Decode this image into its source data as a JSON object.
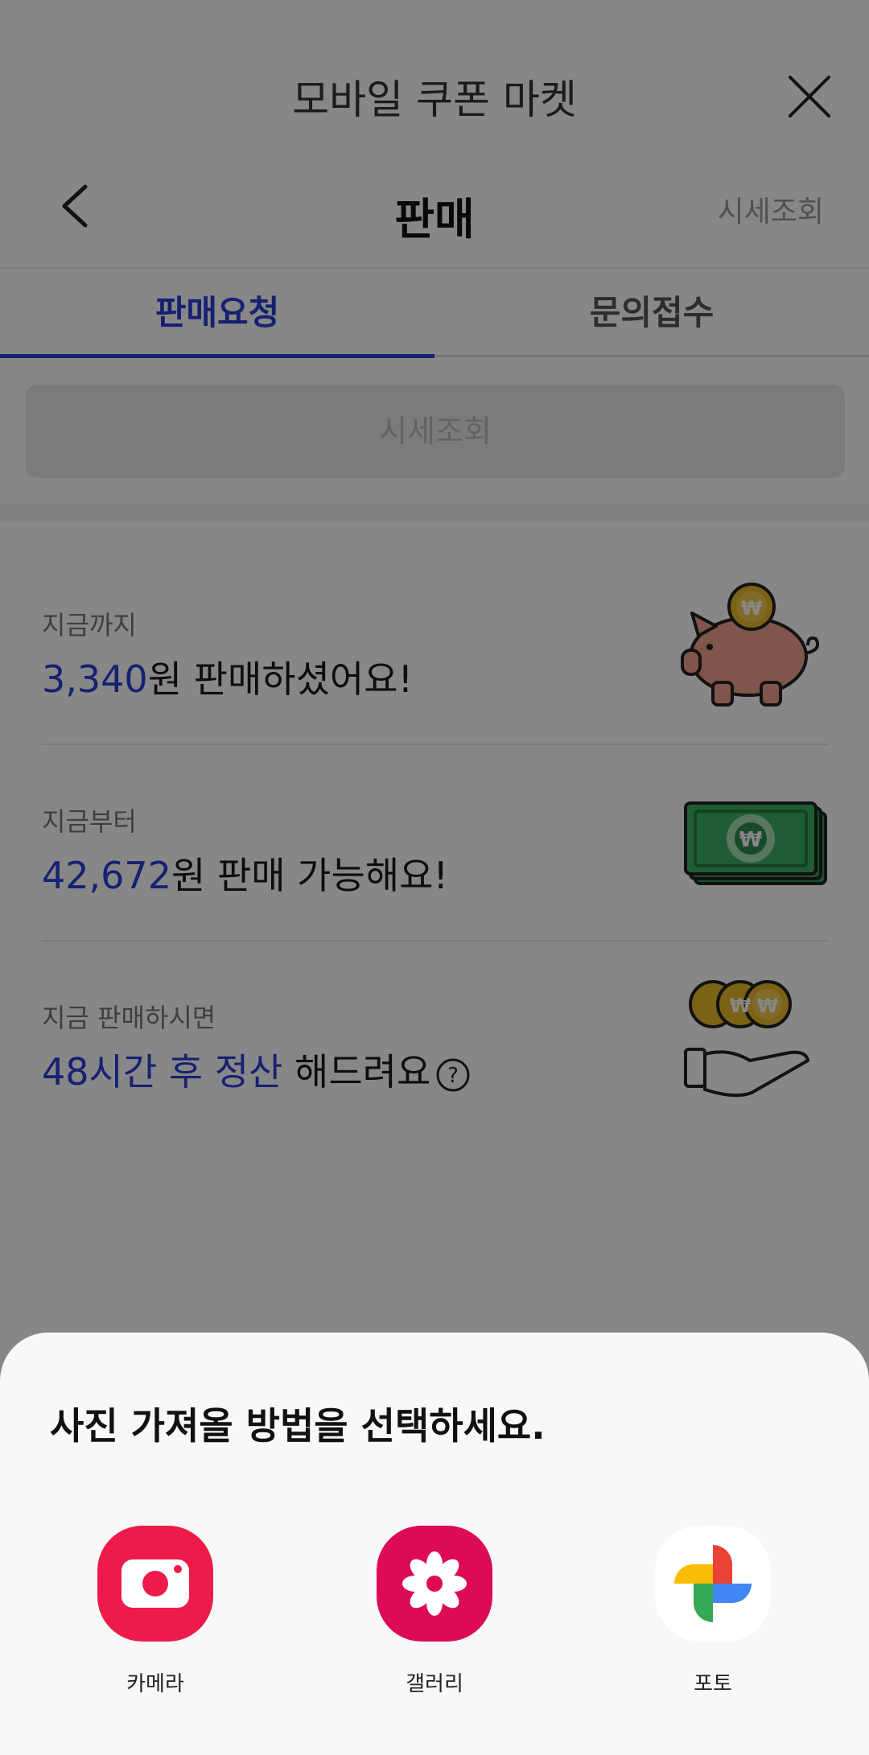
{
  "header": {
    "app_title": "모바일 쿠폰 마켓",
    "page_title": "판매",
    "price_link": "시세조회"
  },
  "tabs": [
    {
      "label": "판매요청",
      "active": true
    },
    {
      "label": "문의접수",
      "active": false
    }
  ],
  "lookup_button": "시세조회",
  "info_rows": [
    {
      "label": "지금까지",
      "highlight": "3,340",
      "text": "원 판매하셨어요!",
      "icon": "piggy-bank-icon"
    },
    {
      "label": "지금부터",
      "highlight": "42,672",
      "text": "원 판매 가능해요!",
      "icon": "cash-stack-icon"
    },
    {
      "label": "지금 판매하시면",
      "highlight": "48시간 후 정산",
      "text": " 해드려요",
      "icon": "coins-hand-icon"
    }
  ],
  "bottom_sheet": {
    "title": "사진 가져올 방법을 선택하세요.",
    "options": [
      {
        "label": "카메라",
        "icon": "camera-app-icon",
        "color": "#ee1b4a"
      },
      {
        "label": "갤러리",
        "icon": "gallery-app-icon",
        "color": "#dc0a57"
      },
      {
        "label": "포토",
        "icon": "google-photos-icon",
        "color": "#ffffff"
      }
    ]
  },
  "colors": {
    "accent": "#2a3fd8",
    "overlay": "rgba(0,0,0,0.47)"
  }
}
